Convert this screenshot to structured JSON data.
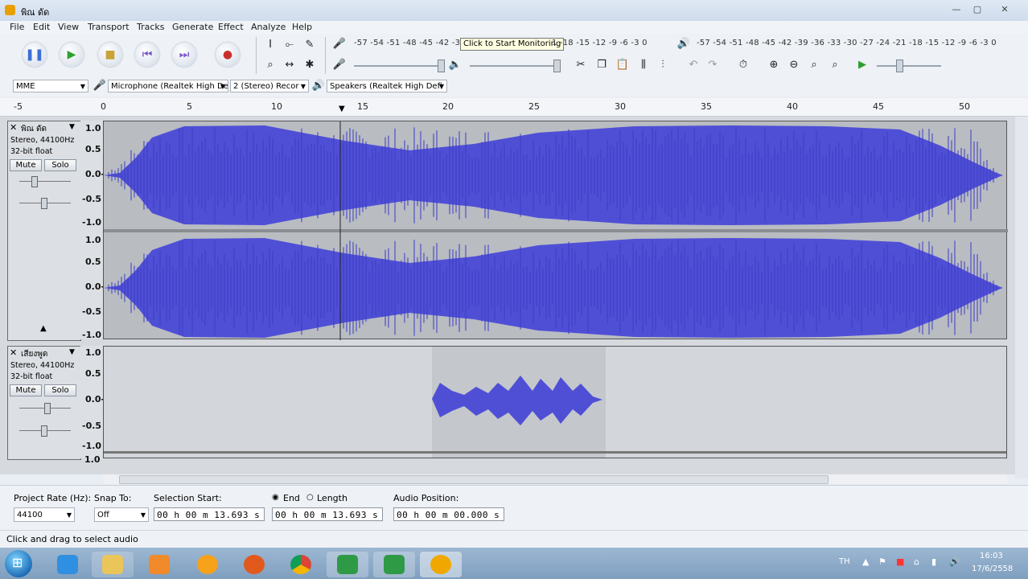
{
  "window": {
    "title": "พิณ ดัด"
  },
  "menu": [
    "File",
    "Edit",
    "View",
    "Transport",
    "Tracks",
    "Generate",
    "Effect",
    "Analyze",
    "Help"
  ],
  "meters": {
    "record_scale": "-57 -54 -51 -48 -45 -42 -3",
    "monitor_tooltip": "Click to Start Monitoring",
    "record_scale_tail": "1 -18 -15 -12 -9 -6 -3 0",
    "play_scale": "-57 -54 -51 -48 -45 -42 -39 -36 -33 -30 -27 -24 -21 -18 -15 -12 -9 -6 -3 0"
  },
  "devices": {
    "host": "MME",
    "recording_device": "Microphone (Realtek High De",
    "channels": "2 (Stereo) Recor",
    "playback_device": "Speakers (Realtek High Defi"
  },
  "ruler": [
    "-5",
    "0",
    "5",
    "10",
    "15",
    "20",
    "25",
    "30",
    "35",
    "40",
    "45",
    "50"
  ],
  "tracks": [
    {
      "name": "พิณ ดัด",
      "format": "Stereo, 44100Hz",
      "bits": "32-bit float",
      "mute": "Mute",
      "solo": "Solo",
      "scale_top": [
        "1.0",
        "0.5",
        "0.0-",
        "-0.5",
        "-1.0"
      ],
      "scale_bottom": [
        "1.0",
        "0.5",
        "0.0-",
        "-0.5",
        "-1.0"
      ]
    },
    {
      "name": "เสียงพูด",
      "format": "Stereo, 44100Hz",
      "bits": "32-bit float",
      "mute": "Mute",
      "solo": "Solo",
      "scale_top": [
        "1.0",
        "0.5",
        "0.0-",
        "-0.5",
        "-1.0"
      ],
      "scale_bottom_first": "1.0"
    }
  ],
  "selection_toolbar": {
    "project_rate_label": "Project Rate (Hz):",
    "project_rate": "44100",
    "snap_label": "Snap To:",
    "snap_value": "Off",
    "sel_start_label": "Selection Start:",
    "sel_start": "00 h 00 m 13.693 s",
    "end_label": "End",
    "length_label": "Length",
    "end_value": "00 h 00 m 13.693 s",
    "audio_pos_label": "Audio Position:",
    "audio_pos": "00 h 00 m 00.000 s"
  },
  "status": "Click and drag to select audio",
  "taskbar": {
    "lang": "TH",
    "time": "16:03",
    "date": "17/6/2558"
  },
  "colors": {
    "wave": "#4f4fd6",
    "selection": "#c9ccd1",
    "taskbar": "#8aa9c8"
  }
}
